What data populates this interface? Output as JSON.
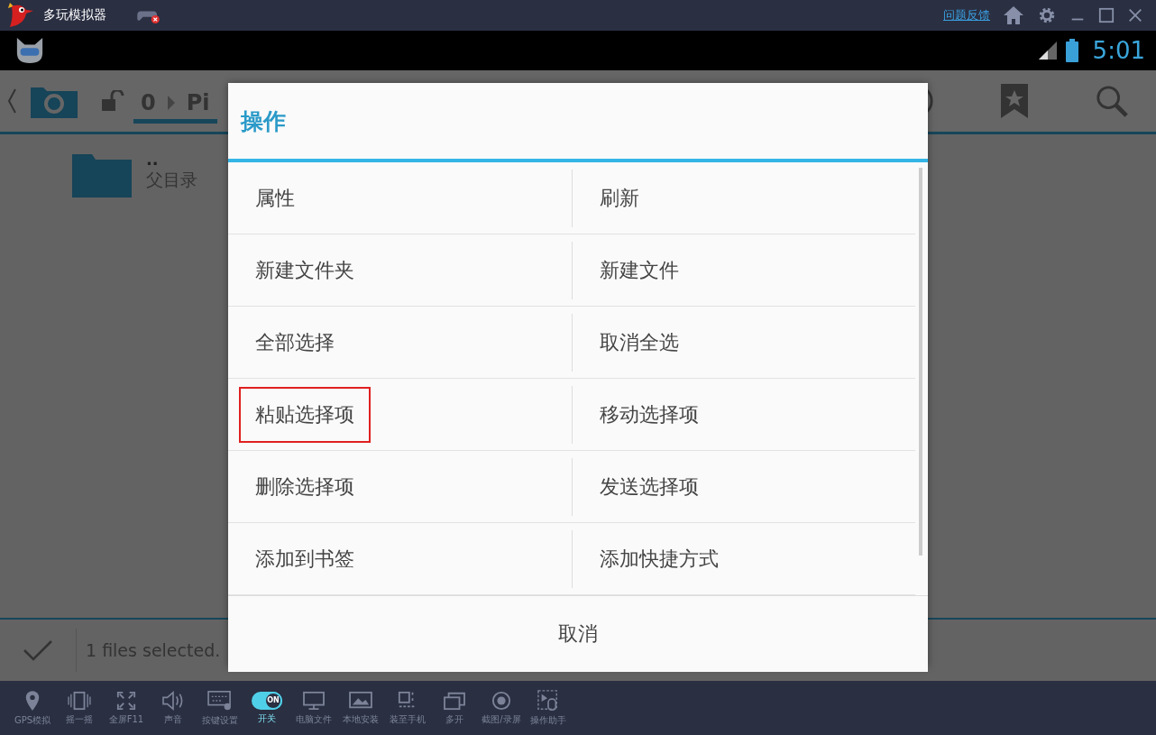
{
  "window": {
    "title": "多玩模拟器",
    "feedback_link": "问题反馈"
  },
  "status_bar": {
    "time": "5:01"
  },
  "app_toolbar": {
    "path_count": "0",
    "path_segment": "Pi"
  },
  "files": [
    {
      "name": "..",
      "description": "父目录"
    }
  ],
  "action_bar": {
    "message": "1 files selected."
  },
  "dialog": {
    "title": "操作",
    "rows": [
      [
        {
          "label": "属性",
          "highlighted": false
        },
        {
          "label": "刷新",
          "highlighted": false
        }
      ],
      [
        {
          "label": "新建文件夹",
          "highlighted": false
        },
        {
          "label": "新建文件",
          "highlighted": false
        }
      ],
      [
        {
          "label": "全部选择",
          "highlighted": false
        },
        {
          "label": "取消全选",
          "highlighted": false
        }
      ],
      [
        {
          "label": "粘贴选择项",
          "highlighted": true
        },
        {
          "label": "移动选择项",
          "highlighted": false
        }
      ],
      [
        {
          "label": "删除选择项",
          "highlighted": false
        },
        {
          "label": "发送选择项",
          "highlighted": false
        }
      ],
      [
        {
          "label": "添加到书签",
          "highlighted": false
        },
        {
          "label": "添加快捷方式",
          "highlighted": false
        }
      ]
    ],
    "cancel": "取消"
  },
  "emulator_toolbar": [
    {
      "kind": "pin",
      "label": "GPS模拟"
    },
    {
      "kind": "shake",
      "label": "摇一摇"
    },
    {
      "kind": "fullscreen",
      "label": "全屏F11"
    },
    {
      "kind": "sound",
      "label": "声音"
    },
    {
      "kind": "keyboard",
      "label": "按键设置"
    },
    {
      "kind": "switch",
      "label": "开关",
      "badge": "ON",
      "on": true
    },
    {
      "kind": "monitor",
      "label": "电脑文件"
    },
    {
      "kind": "image",
      "label": "本地安装"
    },
    {
      "kind": "phone",
      "label": "装至手机"
    },
    {
      "kind": "windows",
      "label": "多开"
    },
    {
      "kind": "record",
      "label": "截图/录屏"
    },
    {
      "kind": "mouse",
      "label": "操作助手"
    }
  ]
}
